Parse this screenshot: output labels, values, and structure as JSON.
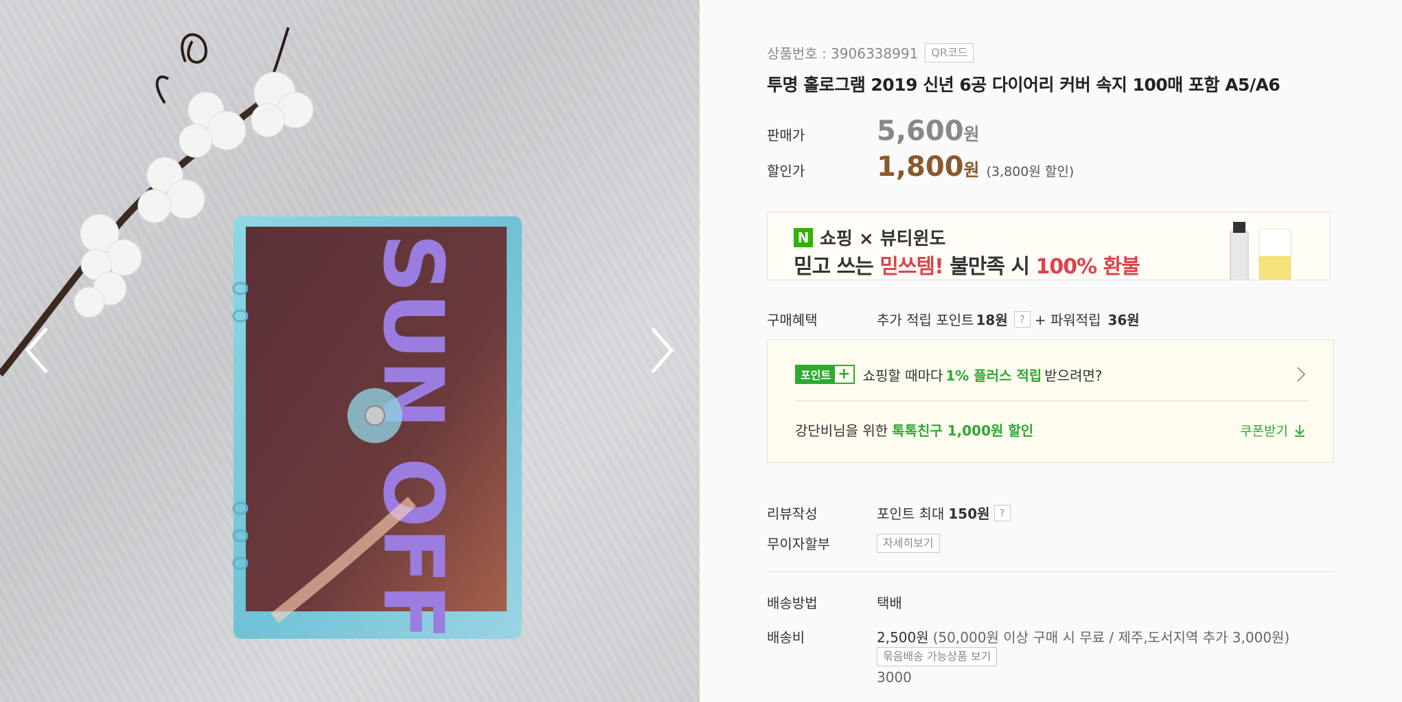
{
  "gallery": {
    "prev_icon": "chevron-left-icon",
    "next_icon": "chevron-right-icon",
    "cover_text": "SUN OFF"
  },
  "product": {
    "id_label": "상품번호 : 3906338991",
    "qr_label": "QR코드",
    "title": "투명 홀로그램 2019 신년 6공 다이어리 커버 속지 100매 포함 A5/A6"
  },
  "price": {
    "orig_label": "판매가",
    "orig_value": "5,600",
    "orig_unit": "원",
    "sale_label": "할인가",
    "sale_value": "1,800",
    "sale_unit": "원",
    "discount_note": "(3,800원 할인)"
  },
  "banner": {
    "logo": "N",
    "line1": "쇼핑 × 뷰티윈도",
    "line2_a": "믿고 쓰는 ",
    "line2_b": "믿쓰템!",
    "line2_c": " 불만족 시 ",
    "line2_d": "100% 환불"
  },
  "benefit": {
    "label": "구매혜택",
    "text_a": "추가 적립 포인트",
    "points": "18원",
    "qmark": "?",
    "text_b": "+ 파워적립",
    "power": "36원"
  },
  "point_box": {
    "badge": "포인트",
    "badge_plus": "+",
    "text_a": "쇼핑할 때마다",
    "highlight": "1% 플러스 적립",
    "text_b": "받으려면?",
    "coupon_text_a": "강단비님을 위한",
    "coupon_highlight": "톡톡친구 1,000원 할인",
    "coupon_button": "쿠폰받기"
  },
  "review": {
    "label": "리뷰작성",
    "text": "포인트 최대",
    "value": "150원",
    "qmark": "?"
  },
  "installment": {
    "label": "무이자할부",
    "button": "자세히보기"
  },
  "shipping": {
    "method_label": "배송방법",
    "method_value": "택배",
    "fee_label": "배송비",
    "fee_value": "2,500원",
    "fee_note": "(50,000원 이상 구매 시 무료 / 제주,도서지역 추가 3,000원)",
    "bundle_button": "묶음배송 가능상품 보기",
    "extra": "3000"
  },
  "colors": {
    "sale_price": "#8a5a2b",
    "green": "#2fa834",
    "banner_red": "#e0414b"
  }
}
